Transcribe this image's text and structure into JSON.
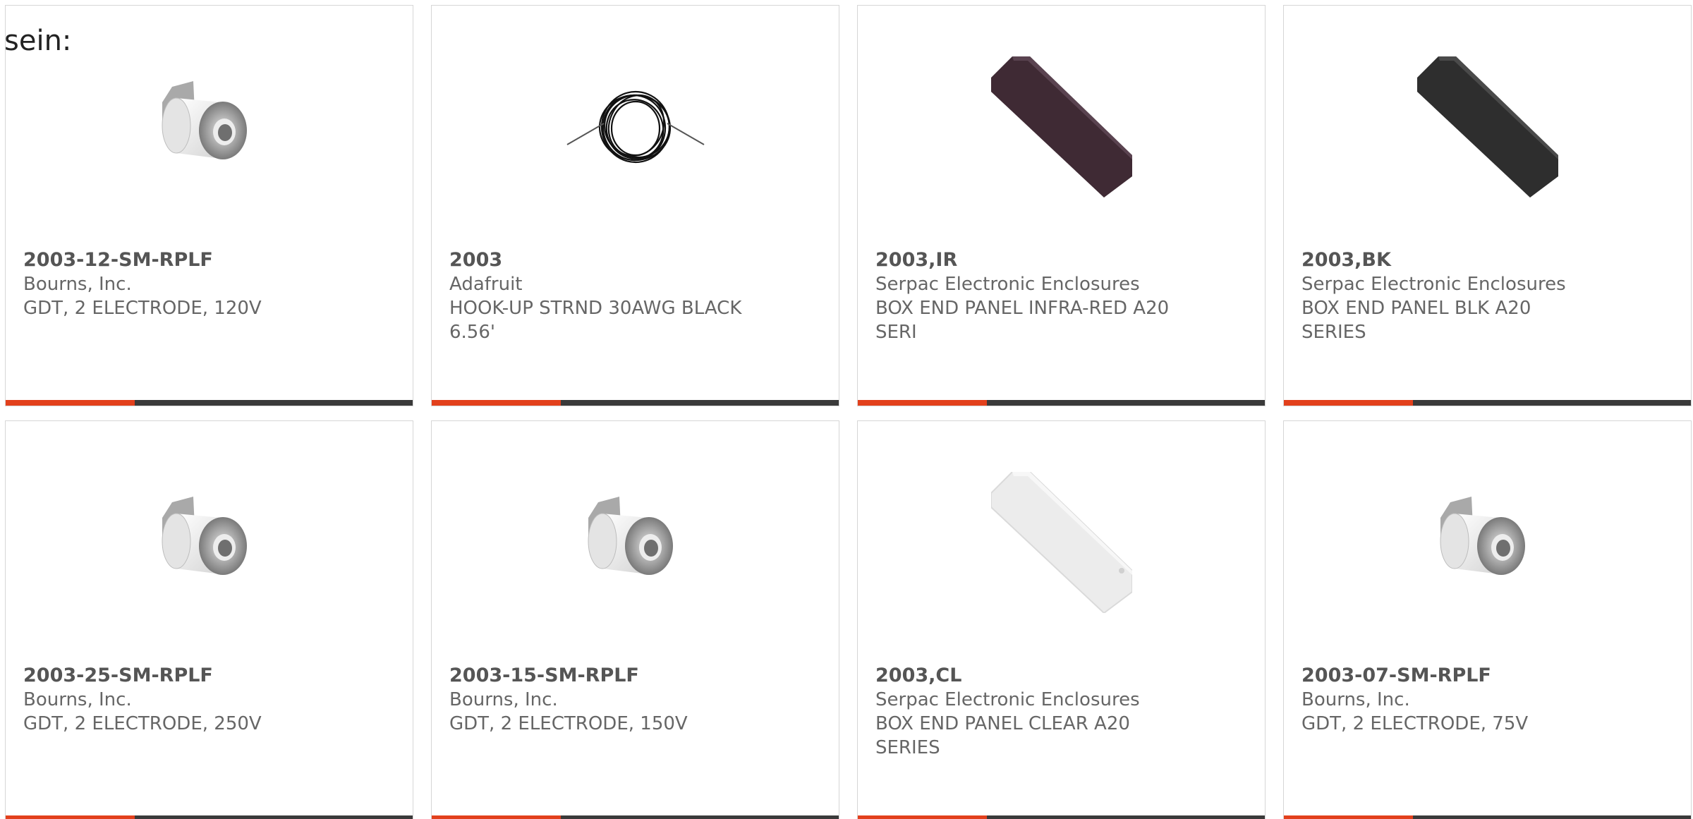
{
  "lead_text": "sein:",
  "colors": {
    "accent": "#e2401c",
    "bar_dark": "#3a3a3a",
    "card_border": "#d6d6d6",
    "text_gray": "#666666"
  },
  "cards": [
    {
      "part": "2003-12-SM-RPLF",
      "maker": "Bourns, Inc.",
      "desc": "GDT, 2 ELECTRODE, 120V",
      "icon": "gas-discharge-tube-icon"
    },
    {
      "part": "2003",
      "maker": "Adafruit",
      "desc": "HOOK-UP STRND 30AWG BLACK 6.56'",
      "icon": "wire-coil-icon"
    },
    {
      "part": "2003,IR",
      "maker": "Serpac Electronic Enclosures",
      "desc": "BOX END PANEL INFRA-RED A20 SERI",
      "icon": "end-panel-icon"
    },
    {
      "part": "2003,BK",
      "maker": "Serpac Electronic Enclosures",
      "desc": "BOX END PANEL BLK A20 SERIES",
      "icon": "end-panel-icon"
    },
    {
      "part": "2003-25-SM-RPLF",
      "maker": "Bourns, Inc.",
      "desc": "GDT, 2 ELECTRODE, 250V",
      "icon": "gas-discharge-tube-icon"
    },
    {
      "part": "2003-15-SM-RPLF",
      "maker": "Bourns, Inc.",
      "desc": "GDT, 2 ELECTRODE, 150V",
      "icon": "gas-discharge-tube-icon"
    },
    {
      "part": "2003,CL",
      "maker": "Serpac Electronic Enclosures",
      "desc": "BOX END PANEL CLEAR A20 SERIES",
      "icon": "end-panel-icon"
    },
    {
      "part": "2003-07-SM-RPLF",
      "maker": "Bourns, Inc.",
      "desc": "GDT, 2 ELECTRODE, 75V",
      "icon": "gas-discharge-tube-icon"
    }
  ]
}
